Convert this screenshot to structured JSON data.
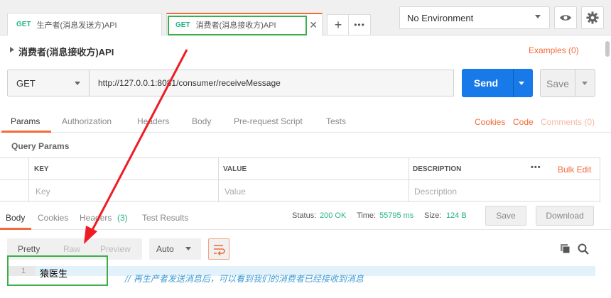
{
  "tabs": [
    {
      "method": "GET",
      "label": "生产者(消息发送方)API"
    },
    {
      "method": "GET",
      "label": "消费者(消息接收方)API"
    }
  ],
  "tab_close": "✕",
  "new_tab": "+",
  "more_tabs": "•••",
  "environment": {
    "selected": "No Environment"
  },
  "request": {
    "name": "消费者(消息接收方)API",
    "examples": "Examples (0)",
    "method": "GET",
    "url": "http://127.0.0.1:8081/consumer/receiveMessage",
    "send_label": "Send",
    "save_label": "Save"
  },
  "request_tabs": {
    "params": "Params",
    "authorization": "Authorization",
    "headers": "Headers",
    "body": "Body",
    "prerequest": "Pre-request Script",
    "tests": "Tests",
    "cookies": "Cookies",
    "code": "Code",
    "comments": "Comments (0)"
  },
  "query_params": {
    "title": "Query Params",
    "headers": {
      "key": "KEY",
      "value": "VALUE",
      "description": "DESCRIPTION"
    },
    "more": "•••",
    "bulk_edit": "Bulk Edit",
    "placeholders": {
      "key": "Key",
      "value": "Value",
      "description": "Description"
    }
  },
  "response_tabs": {
    "body": "Body",
    "cookies": "Cookies",
    "headers": "Headers",
    "headers_count": "(3)",
    "test_results": "Test Results"
  },
  "response_status": {
    "status_label": "Status:",
    "status": "200 OK",
    "time_label": "Time:",
    "time": "55795 ms",
    "size_label": "Size:",
    "size": "124 B"
  },
  "response_actions": {
    "save": "Save",
    "download": "Download"
  },
  "format": {
    "pretty": "Pretty",
    "raw": "Raw",
    "preview": "Preview",
    "auto": "Auto"
  },
  "response_body": {
    "line_number": "1",
    "text": "猿医生"
  },
  "annotation": {
    "note": "// 再生产者发送消息后，可以看到我们的消费者已经接收到消息"
  },
  "colors": {
    "accent": "#f26b3a",
    "send": "#1879e8",
    "success": "#26b47f",
    "annotation": "#3daf4a",
    "arrow": "#ee1c24",
    "note": "#3b9bd4"
  },
  "icons": [
    "chevron-right-icon",
    "caret-down-icon",
    "eye-icon",
    "gear-icon",
    "wrap-icon",
    "copy-icon",
    "search-icon"
  ]
}
